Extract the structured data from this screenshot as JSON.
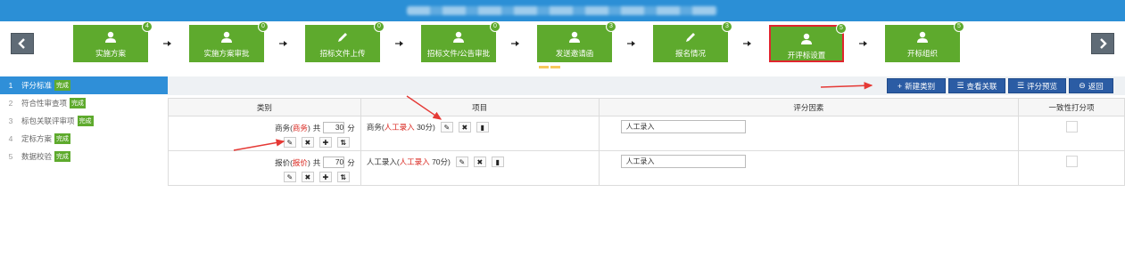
{
  "topbar": {
    "title": ""
  },
  "steps": [
    {
      "label": "实施方案",
      "badge": "4",
      "icon": "user-icon"
    },
    {
      "label": "实施方案审批",
      "badge": "0",
      "icon": "user-icon"
    },
    {
      "label": "招标文件上传",
      "badge": "0",
      "icon": "pencil-icon"
    },
    {
      "label": "招标文件/公告审批",
      "badge": "0",
      "icon": "user-icon"
    },
    {
      "label": "发送邀请函",
      "badge": "3",
      "icon": "user-icon"
    },
    {
      "label": "报名情况",
      "badge": "3",
      "icon": "pencil-icon"
    },
    {
      "label": "开评标设置",
      "badge": "5",
      "icon": "user-icon"
    },
    {
      "label": "开标组织",
      "badge": "5",
      "icon": "user-icon"
    }
  ],
  "sidebar": {
    "items": [
      {
        "num": "1",
        "label": "评分标准",
        "tag": "完成"
      },
      {
        "num": "2",
        "label": "符合性审查项",
        "tag": "完成"
      },
      {
        "num": "3",
        "label": "标包关联评审项",
        "tag": "完成"
      },
      {
        "num": "4",
        "label": "定标方案",
        "tag": "完成"
      },
      {
        "num": "5",
        "label": "数据校验",
        "tag": "完成"
      }
    ]
  },
  "actions": {
    "new_category": "新建类别",
    "view_relation": "查看关联",
    "score_preview": "评分预览",
    "back": "返回"
  },
  "table": {
    "headers": [
      "类别",
      "项目",
      "评分因素",
      "一致性打分项"
    ],
    "rows": [
      {
        "cat_name": "商务",
        "cat_paren": "商务",
        "total_label": "共",
        "score": "30",
        "unit": "分",
        "item_name": "商务",
        "item_paren": "人工录入",
        "item_score": "30分",
        "factor": "人工录入"
      },
      {
        "cat_name": "报价",
        "cat_paren": "报价",
        "total_label": "共",
        "score": "70",
        "unit": "分",
        "item_name": "人工录入",
        "item_paren": "人工录入",
        "item_score": "70分",
        "factor": "人工录入"
      }
    ]
  },
  "colors": {
    "topbar": "#2b8fd6",
    "step_green": "#5eaa2d",
    "active_border": "#e0252e",
    "sidebar_active": "#2f8fd8",
    "action_button": "#2b5ca4",
    "annotation_red": "#e53935"
  }
}
